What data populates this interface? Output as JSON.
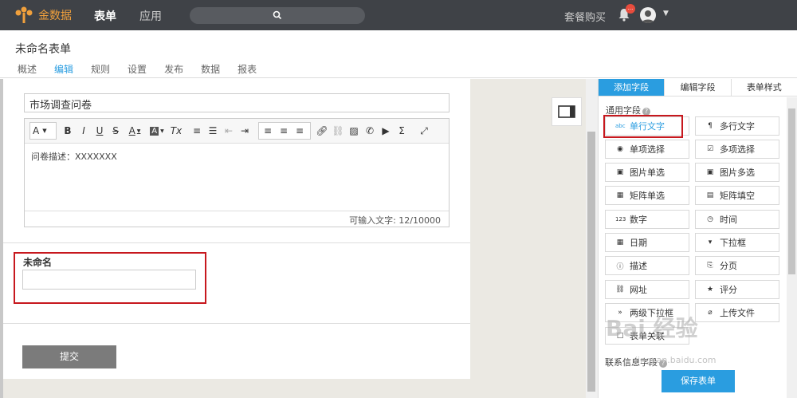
{
  "topbar": {
    "brand": "金数据",
    "nav": [
      "表单",
      "应用"
    ],
    "package_link": "套餐购买",
    "notification_badge": "..."
  },
  "subheader": {
    "form_title": "未命名表单",
    "tabs": [
      "概述",
      "编辑",
      "规则",
      "设置",
      "发布",
      "数据",
      "报表"
    ],
    "active_tab": "编辑"
  },
  "form": {
    "title_value": "市场调查问卷",
    "description": "问卷描述：XXXXXXX",
    "char_counter": "可输入文字: 12/10000",
    "field_label": "未命名",
    "field_value": "",
    "submit_label": "提交"
  },
  "toolbar": {
    "font_label": "A",
    "bold": "B",
    "italic": "I",
    "underline": "U",
    "strike": "S",
    "font_color": "A",
    "bg_color": "A",
    "clear_format": "Tx",
    "sigma": "Σ"
  },
  "right_panel": {
    "tabs": [
      "添加字段",
      "编辑字段",
      "表单样式"
    ],
    "active_tab": "添加字段",
    "common_fields_title": "通用字段",
    "fields": [
      {
        "label": "单行文字",
        "icon": "abc"
      },
      {
        "label": "多行文字",
        "icon": "¶"
      },
      {
        "label": "单项选择",
        "icon": "◉"
      },
      {
        "label": "多项选择",
        "icon": "☑"
      },
      {
        "label": "图片单选",
        "icon": "▣"
      },
      {
        "label": "图片多选",
        "icon": "▣"
      },
      {
        "label": "矩阵单选",
        "icon": "▦"
      },
      {
        "label": "矩阵填空",
        "icon": "▤"
      },
      {
        "label": "数字",
        "icon": "123"
      },
      {
        "label": "时间",
        "icon": "◷"
      },
      {
        "label": "日期",
        "icon": "▦"
      },
      {
        "label": "下拉框",
        "icon": "▾"
      },
      {
        "label": "描述",
        "icon": "ⓘ"
      },
      {
        "label": "分页",
        "icon": "⎘"
      },
      {
        "label": "网址",
        "icon": "⛓"
      },
      {
        "label": "评分",
        "icon": "★"
      },
      {
        "label": "两级下拉框",
        "icon": "»"
      },
      {
        "label": "上传文件",
        "icon": "⌀"
      },
      {
        "label": "表单关联",
        "icon": "□"
      }
    ],
    "contact_fields_title": "联系信息字段",
    "save_label": "保存表单"
  },
  "watermark": {
    "main": "Bai 经验",
    "sub": "jingyan.baidu.com"
  },
  "colors": {
    "accent": "#2a9de0",
    "topbar": "#3f4247",
    "highlight_red": "#c7181e",
    "brand_orange": "#f0a03c"
  }
}
